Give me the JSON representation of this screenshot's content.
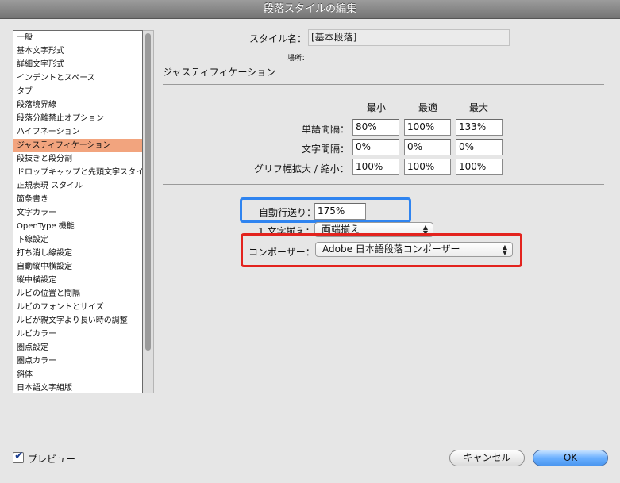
{
  "window": {
    "title": "段落スタイルの編集"
  },
  "sidebar": {
    "items": [
      "一般",
      "基本文字形式",
      "詳細文字形式",
      "インデントとスペース",
      "タブ",
      "段落境界線",
      "段落分離禁止オプション",
      "ハイフネーション",
      "ジャスティフィケーション",
      "段抜きと段分割",
      "ドロップキャップと先頭文字スタイル",
      "正規表現 スタイル",
      "箇条書き",
      "文字カラー",
      "OpenType 機能",
      "下線設定",
      "打ち消し線設定",
      "自動縦中横設定",
      "縦中横設定",
      "ルビの位置と間隔",
      "ルビのフォントとサイズ",
      "ルビが親文字より長い時の調整",
      "ルビカラー",
      "圏点設定",
      "圏点カラー",
      "斜体",
      "日本語文字組版"
    ],
    "selected_index": 8
  },
  "style": {
    "name_label": "スタイル名：",
    "name_value": "[基本段落]",
    "location_label": "場所："
  },
  "justification": {
    "section_title": "ジャスティフィケーション",
    "col_min": "最小",
    "col_opt": "最適",
    "col_max": "最大",
    "word_spacing_label": "単語間隔：",
    "word_spacing": [
      "80%",
      "100%",
      "133%"
    ],
    "letter_spacing_label": "文字間隔：",
    "letter_spacing": [
      "0%",
      "0%",
      "0%"
    ],
    "glyph_scaling_label": "グリフ幅拡大 / 縮小：",
    "glyph_scaling": [
      "100%",
      "100%",
      "100%"
    ],
    "auto_leading_label": "自動行送り：",
    "auto_leading": "175%",
    "single_word_label": "1 文字揃え：",
    "single_word_value": "両端揃え",
    "composer_label": "コンポーザー：",
    "composer_value": "Adobe 日本語段落コンポーザー"
  },
  "footer": {
    "preview_label": "プレビュー",
    "cancel_label": "キャンセル",
    "ok_label": "OK"
  },
  "colors": {
    "selection": "#f2a47e",
    "blue_highlight": "#2f84f0",
    "red_highlight": "#e3231e"
  }
}
